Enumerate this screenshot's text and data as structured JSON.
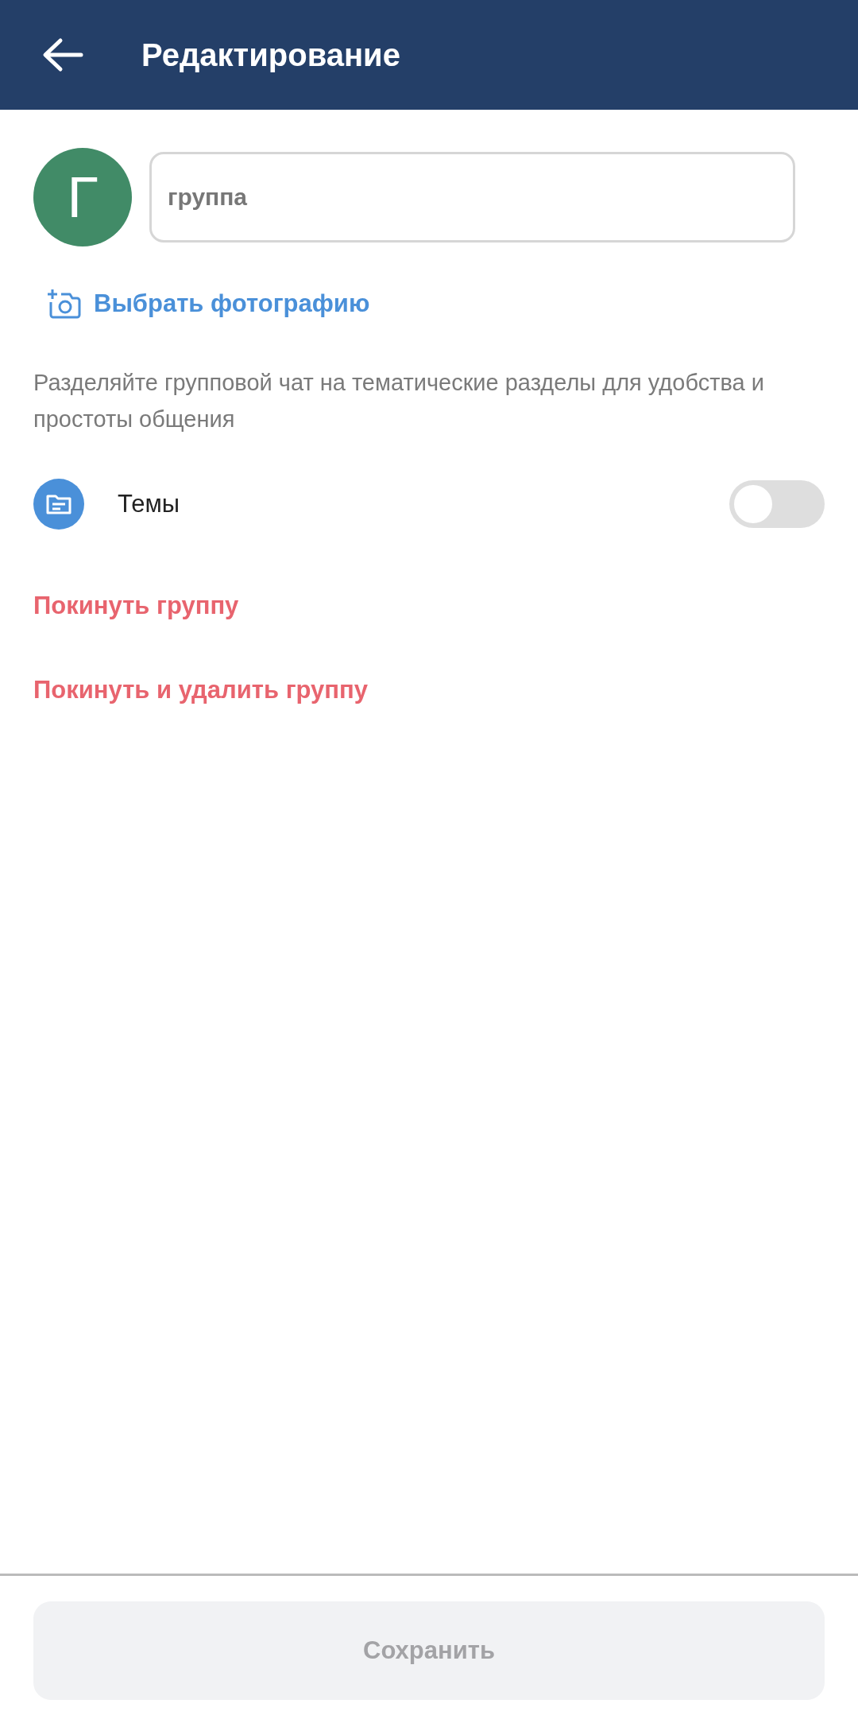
{
  "header": {
    "title": "Редактирование"
  },
  "avatar": {
    "letter": "Г",
    "color": "#418b67"
  },
  "name_field": {
    "value": "группа"
  },
  "photo_link": "Выбрать фотографию",
  "description": "Разделяйте групповой чат на тематические разделы для удобства и простоты общения",
  "topics": {
    "label": "Темы",
    "on": false
  },
  "actions": [
    "Покинуть группу",
    "Покинуть и удалить группу"
  ],
  "save_button": {
    "label": "Сохранить",
    "disabled": true
  }
}
